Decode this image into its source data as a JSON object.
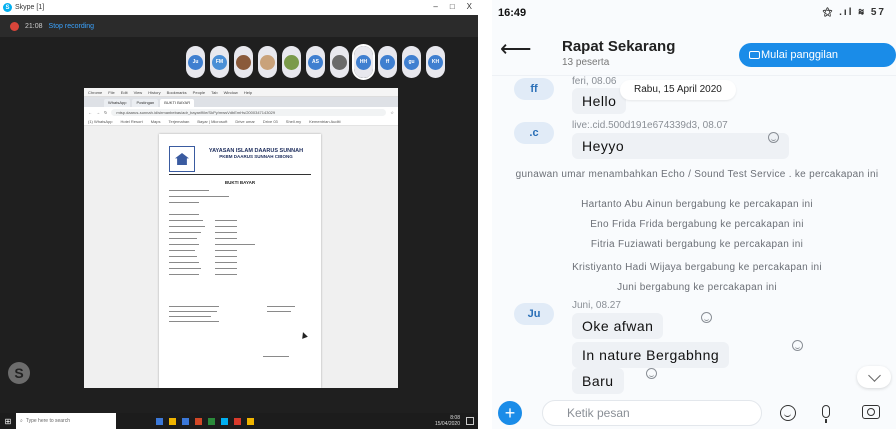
{
  "desktop": {
    "window_title": "Skype [1]",
    "window_controls": [
      "–",
      "□",
      "X"
    ],
    "call_time": "21:08",
    "recording_label": "Stop recording",
    "participants": [
      {
        "initials": "Ju",
        "color": "#3f7fd0"
      },
      {
        "initials": "FM",
        "color": "#4a8fd6"
      },
      {
        "initials": "",
        "color": "#8a5a3a"
      },
      {
        "initials": "",
        "color": "#c9a27a"
      },
      {
        "initials": "",
        "color": "#7a9a4a"
      },
      {
        "initials": "AS",
        "color": "#3f7fd0"
      },
      {
        "initials": "",
        "color": "#6a6a6a"
      },
      {
        "initials": "HH",
        "color": "#3f7fd0"
      },
      {
        "initials": "ff",
        "color": "#3f7fd0"
      },
      {
        "initials": "gu",
        "color": "#3f7fd0"
      },
      {
        "initials": "KH",
        "color": "#3f7fd0"
      }
    ],
    "browser": {
      "menu": [
        "Chrome",
        "File",
        "Edit",
        "View",
        "History",
        "Bookmarks",
        "People",
        "Tab",
        "Window",
        "Help"
      ],
      "tabs": [
        "WhatsApp",
        "Postingan",
        "BUKTI BAYAR"
      ],
      "url": "mtsp.daarus-sunnah.id/sirmanbebas/adr_bayar/fiile/SkPy/mwsVdbEmHs/2000347143029",
      "bookmarks": [
        "(1) WhatsApp",
        "Hotel Resort",
        "Maps",
        "Terjemahan",
        "Bayar | Microsoft",
        "Drive umar",
        "Drive 03",
        "Shell.my",
        "Kementrian Auditi"
      ]
    },
    "document": {
      "institution": "YAYASAN ISLAM DAARUS SUNNAH",
      "school": "PKBM DAARUS SUNNAH CIBONG",
      "title": "BUKTI BAYAR"
    },
    "taskbar": {
      "search_placeholder": "Type here to search",
      "time": "8:08",
      "date": "15/04/2020"
    }
  },
  "phone": {
    "status_time": "16:49",
    "status_icons": "⚝ .ıl ≋ 57",
    "chat": {
      "title": "Rapat Sekarang",
      "member_count": "13 peserta",
      "call_button": "Mulai panggilan",
      "date_chip": "Rabu, 15 April 2020"
    },
    "messages": [
      {
        "avatar": "ff",
        "meta": "feri, 08.06",
        "text": "Hello"
      },
      {
        "avatar": ".c",
        "meta": "live:.cid.500d191e674339d3, 08.07",
        "text": "Heyyo"
      },
      {
        "system": "gunawan umar menambahkan Echo / Sound Test Service . ke percakapan ini"
      },
      {
        "system": "Hartanto Abu Ainun bergabung ke percakapan ini"
      },
      {
        "system": "Eno Frida Frida bergabung ke percakapan ini"
      },
      {
        "system": "Fitria Fuziawati bergabung ke percakapan ini"
      },
      {
        "system": "Kristiyanto Hadi Wijaya bergabung ke percakapan ini"
      },
      {
        "system": "Juni bergabung ke percakapan ini"
      },
      {
        "avatar": "Ju",
        "meta": "Juni, 08.27",
        "texts": [
          "Oke afwan",
          "In nature Bergabhng",
          "Baru"
        ]
      }
    ],
    "composer": {
      "placeholder": "Ketik pesan"
    },
    "icons": {
      "back": "back-arrow-icon",
      "call": "video-camera-icon",
      "plus": "plus-icon",
      "emoji": "smiley-icon",
      "mic": "microphone-icon",
      "camera": "camera-icon",
      "scroll": "chevron-down-icon"
    },
    "colors": {
      "accent": "#1a8ce8",
      "bubble": "#eef1f5",
      "avatar_bg": "#e1ebf7"
    }
  }
}
